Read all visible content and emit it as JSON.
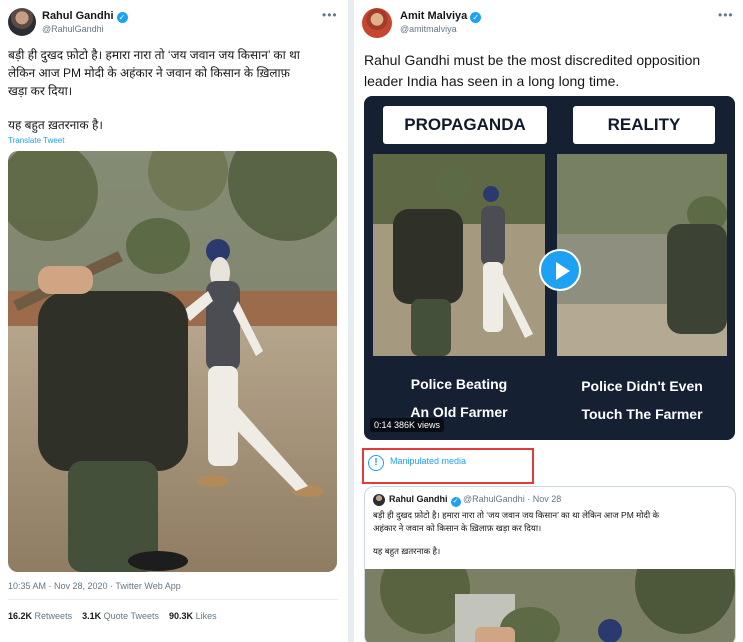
{
  "left_tweet": {
    "author_name": "Rahul Gandhi",
    "author_handle": "@RahulGandhi",
    "verified_mark": "✓",
    "more_label": "•••",
    "text_line1": "बड़ी ही दुखद फ़ोटो है। हमारा नारा तो ‘जय जवान जय किसान’ का था",
    "text_line2": "लेकिन आज PM मोदी के अहंकार ने जवान को किसान के ख़िलाफ़",
    "text_line3": "खड़ा कर दिया।",
    "text_line4": "यह बहुत ख़तरनाक है।",
    "translate_label": "Translate Tweet",
    "timestamp": "10:35 AM · Nov 28, 2020 · Twitter Web App",
    "stats": {
      "retweets_count": "16.2K",
      "retweets_label": "Retweets",
      "quotes_count": "3.1K",
      "quotes_label": "Quote Tweets",
      "likes_count": "90.3K",
      "likes_label": "Likes"
    }
  },
  "right_tweet": {
    "author_name": "Amit Malviya",
    "author_handle": "@amitmalviya",
    "verified_mark": "✓",
    "more_label": "•••",
    "text_line1": "Rahul Gandhi must be the most discredited opposition",
    "text_line2": "leader India has seen in a long long time.",
    "video": {
      "label_left": "PROPAGANDA",
      "label_right": "REALITY",
      "caption_left_line1": "Police Beating",
      "caption_left_line2": "An Old Farmer",
      "caption_right_line1": "Police Didn't Even",
      "caption_right_line2": "Touch The Farmer",
      "counter": "0:14   386K views"
    },
    "manipulated_icon": "!",
    "manipulated_label": "Manipulated media",
    "quoted": {
      "author_name": "Rahul Gandhi",
      "author_handle": "@RahulGandhi",
      "date": "· Nov 28",
      "text_line1": "बड़ी ही दुखद फ़ोटो है। हमारा नारा तो ‘जय जवान जय किसान’ का था लेकिन आज PM मोदी के",
      "text_line2": "अहंकार ने जवान को किसान के ख़िलाफ़ खड़ा कर दिया।",
      "text_line3": "यह बहुत ख़तरनाक है।"
    }
  },
  "colors": {
    "twitter_blue": "#1da1f2",
    "highlight_red": "#e33a3a",
    "video_bg": "#152033"
  },
  "icons": [
    "verified-badge-icon",
    "more-options-icon",
    "play-icon",
    "info-icon"
  ]
}
